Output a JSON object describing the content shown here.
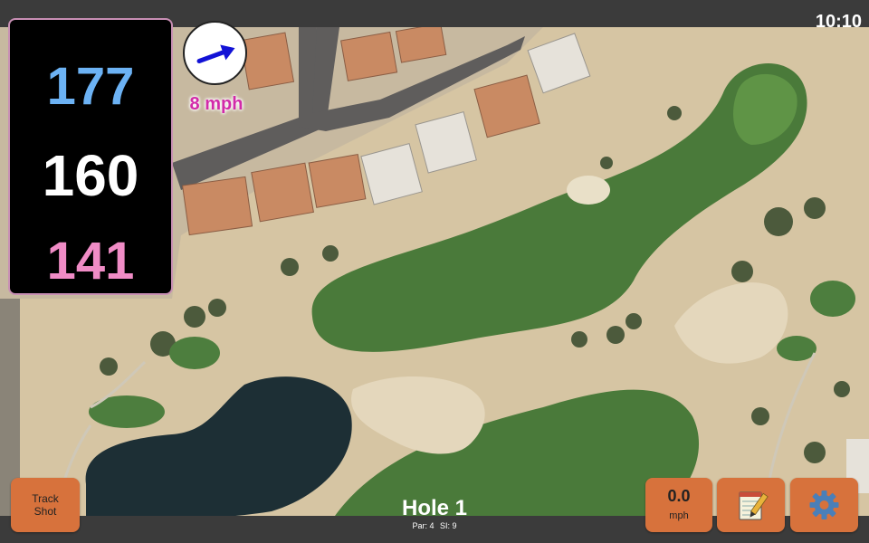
{
  "status_bar": {
    "time": "10:10"
  },
  "distances": {
    "back": "177",
    "middle": "160",
    "front": "141"
  },
  "wind": {
    "speed_label": "8 mph",
    "direction_icon": "arrow-icon"
  },
  "buttons": {
    "track_shot_line1": "Track",
    "track_shot_line2": "Shot",
    "wind_value": "0.0",
    "wind_unit": "mph",
    "notes_icon": "notepad-icon",
    "settings_icon": "gear-icon"
  },
  "hole": {
    "title": "Hole 1",
    "par": "Par: 4",
    "si": "SI: 9"
  },
  "colors": {
    "back_distance": "#6cb2f4",
    "middle_distance": "#ffffff",
    "front_distance": "#f08cc6",
    "wind_text": "#d22aa9",
    "button": "#d7723c"
  }
}
